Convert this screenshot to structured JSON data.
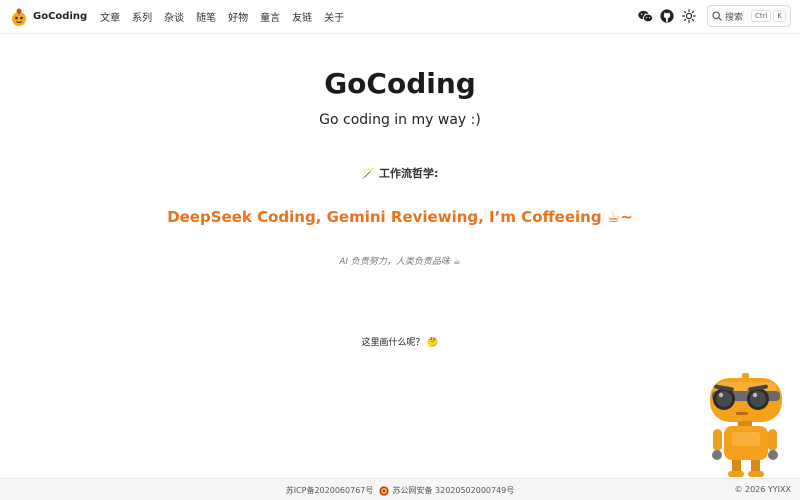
{
  "header": {
    "brand": "GoCoding",
    "nav": [
      "文章",
      "系列",
      "杂谈",
      "随笔",
      "好物",
      "童言",
      "友链",
      "关于"
    ],
    "search": {
      "label": "搜索",
      "shortcut_mod": "Ctrl",
      "shortcut_key": "K"
    }
  },
  "hero": {
    "title": "GoCoding",
    "tagline": "Go coding in my way :)",
    "philosophy": "🪄 工作流哲学:",
    "workflow": "DeepSeek Coding, Gemini Reviewing, I’m Coffeeing ☕~",
    "motto": "AI 负责努力，人类负责品味 ☕",
    "question": "这里画什么呢？ 🤔"
  },
  "footer": {
    "icp": "苏ICP备2020060767号",
    "police": "苏公网安备 32020502000749号",
    "copyright": "© 2026 YYIXX"
  },
  "colors": {
    "accent": "#e8731c"
  }
}
